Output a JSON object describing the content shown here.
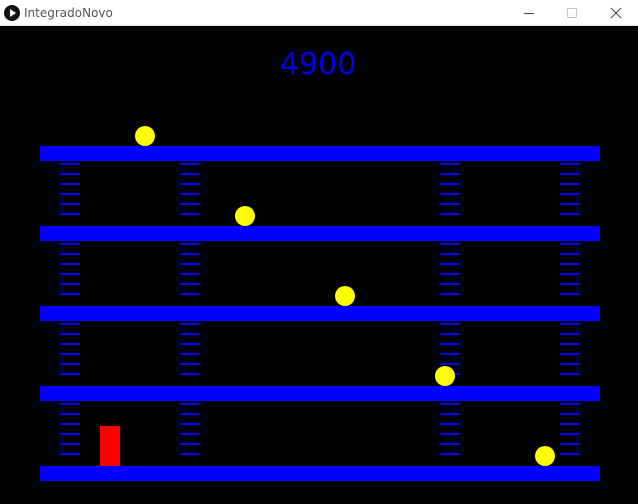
{
  "window": {
    "title": "IntegradoNovo"
  },
  "hud": {
    "score": "4900"
  },
  "colors": {
    "background": "#000000",
    "platform": "#0000ff",
    "ladder": "#0000ff",
    "ball": "#ffff00",
    "player": "#ff0000",
    "score": "#0000ee"
  },
  "icons": {
    "app": "play-icon",
    "minimize": "minimize-icon",
    "maximize": "maximize-icon",
    "close": "close-icon"
  }
}
